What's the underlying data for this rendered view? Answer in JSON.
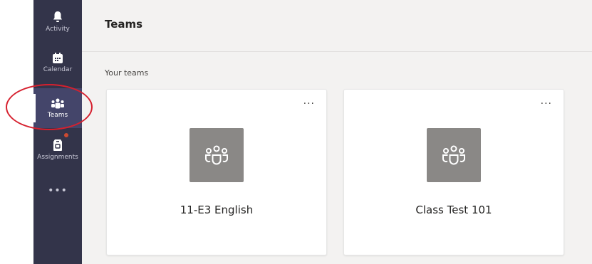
{
  "rail": {
    "items": [
      {
        "label": "Activity",
        "icon": "bell-icon"
      },
      {
        "label": "Calendar",
        "icon": "calendar-icon"
      },
      {
        "label": "Teams",
        "icon": "teams-icon",
        "active": true
      },
      {
        "label": "Assignments",
        "icon": "assignments-icon",
        "has_badge": true
      }
    ],
    "more": "•••"
  },
  "header": {
    "title": "Teams"
  },
  "section_label": "Your teams",
  "teams": [
    {
      "name": "11-E3 English",
      "more": "···"
    },
    {
      "name": "Class Test 101",
      "more": "···"
    }
  ],
  "colors": {
    "rail_bg": "#33344a",
    "tile_bg": "#8a8886",
    "highlight": "#d6202e",
    "badge": "#cc4a31"
  }
}
